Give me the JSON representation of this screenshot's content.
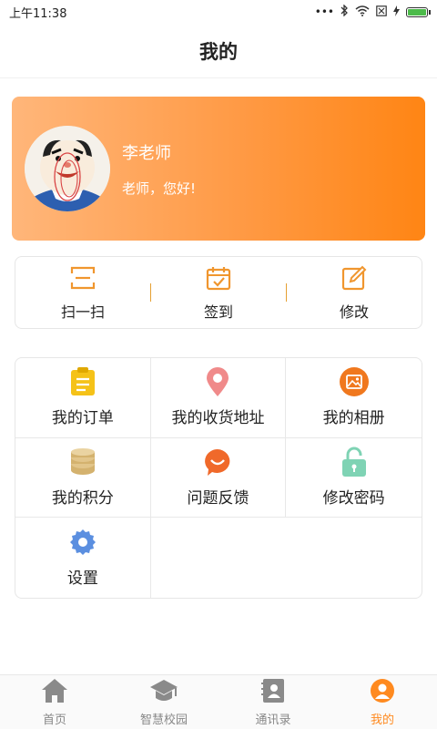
{
  "status_bar": {
    "time": "上午11:38",
    "dots": "•••",
    "battery_level": 1.0
  },
  "header": {
    "title": "我的"
  },
  "profile": {
    "name": "李老师",
    "greeting": "老师，您好!"
  },
  "quick_actions": [
    {
      "label": "扫一扫",
      "icon": "scan-icon"
    },
    {
      "label": "签到",
      "icon": "calendar-check-icon"
    },
    {
      "label": "修改",
      "icon": "edit-icon"
    }
  ],
  "menu": [
    {
      "label": "我的订单",
      "icon": "order-clipboard-icon",
      "color": "#f5c218"
    },
    {
      "label": "我的收货地址",
      "icon": "location-pin-icon",
      "color": "#f08a8a"
    },
    {
      "label": "我的相册",
      "icon": "album-icon",
      "color": "#f0781e"
    },
    {
      "label": "我的积分",
      "icon": "coins-icon",
      "color": "#d4b26e"
    },
    {
      "label": "问题反馈",
      "icon": "feedback-bubble-icon",
      "color": "#f0692a"
    },
    {
      "label": "修改密码",
      "icon": "unlock-icon",
      "color": "#7fd3b4"
    },
    {
      "label": "设置",
      "icon": "settings-gear-icon",
      "color": "#5b8fe0"
    }
  ],
  "bottom_nav": [
    {
      "label": "首页",
      "icon": "home-icon"
    },
    {
      "label": "智慧校园",
      "icon": "graduation-cap-icon"
    },
    {
      "label": "通讯录",
      "icon": "contacts-icon"
    },
    {
      "label": "我的",
      "icon": "user-icon"
    }
  ],
  "colors": {
    "accent": "#ff8a1f",
    "card_gradient_start": "#ffb67a",
    "card_gradient_end": "#ff8514"
  }
}
